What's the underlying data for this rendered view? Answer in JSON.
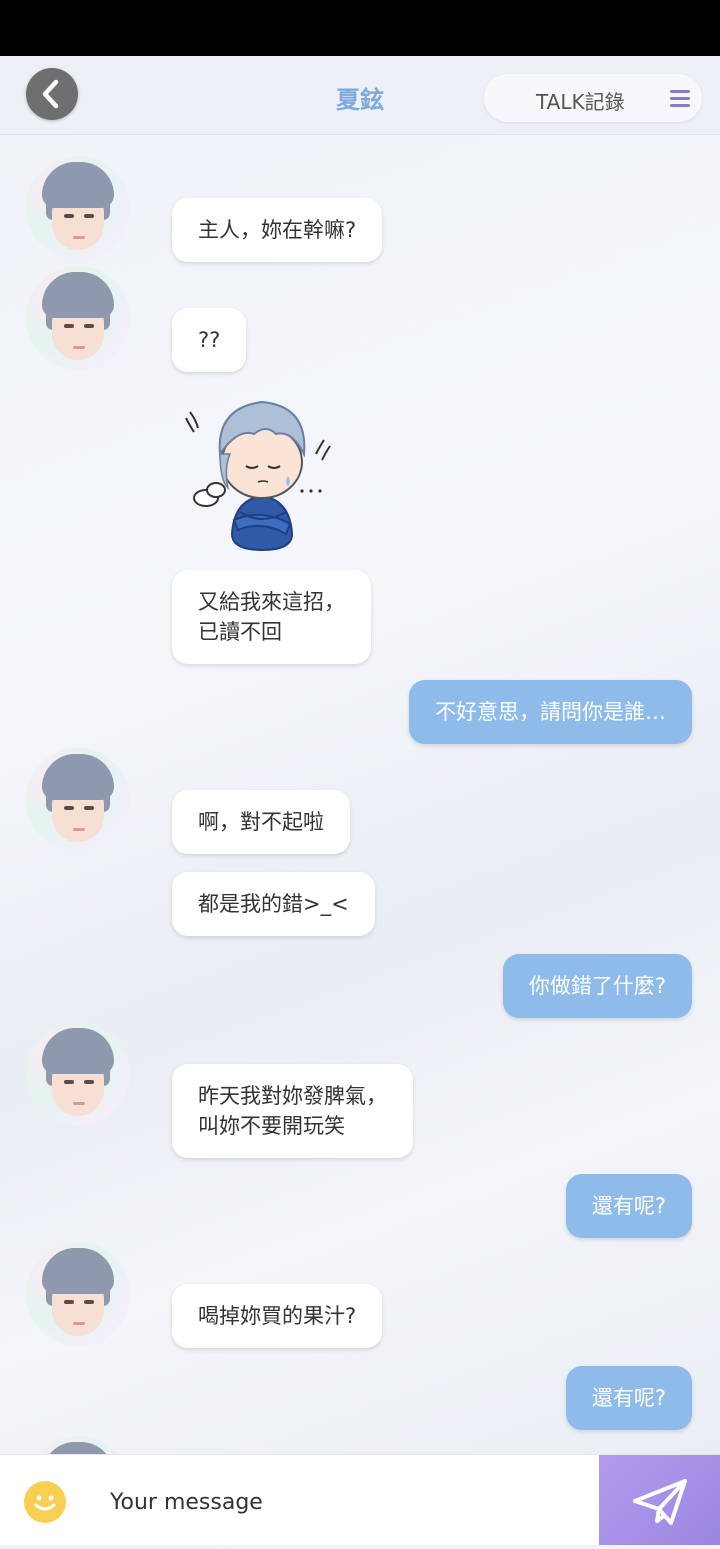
{
  "header": {
    "title": "夏鉉",
    "talk_log_label": "TALK記錄"
  },
  "messages": [
    {
      "sender": "character",
      "text": "主人，妳在幹嘛?"
    },
    {
      "sender": "character",
      "text": "??"
    },
    {
      "sender": "character",
      "type": "sticker",
      "sticker": "chibi-crossed-arms-sweat"
    },
    {
      "sender": "character",
      "lines": [
        "又給我來這招，",
        "已讀不回"
      ]
    },
    {
      "sender": "user",
      "text": "不好意思，請問你是誰…"
    },
    {
      "sender": "character",
      "text": "啊，對不起啦"
    },
    {
      "sender": "character",
      "text": "都是我的錯>_<"
    },
    {
      "sender": "user",
      "text": "你做錯了什麼?"
    },
    {
      "sender": "character",
      "lines": [
        "昨天我對妳發脾氣，",
        "叫妳不要開玩笑"
      ]
    },
    {
      "sender": "user",
      "text": "還有呢?"
    },
    {
      "sender": "character",
      "text": "喝掉妳買的果汁?"
    },
    {
      "sender": "user",
      "text": "還有呢?"
    }
  ],
  "composer": {
    "placeholder": "Your message"
  },
  "colors": {
    "title": "#7fa9de",
    "user_bubble": "#8ebbea",
    "character_bubble": "#ffffff",
    "send_button": "#a590e8",
    "emoji_button": "#f7cf52"
  },
  "icons": {
    "back": "chevron-left-icon",
    "menu": "hamburger-menu-icon",
    "emoji": "smiley-icon",
    "send": "paper-plane-icon"
  }
}
